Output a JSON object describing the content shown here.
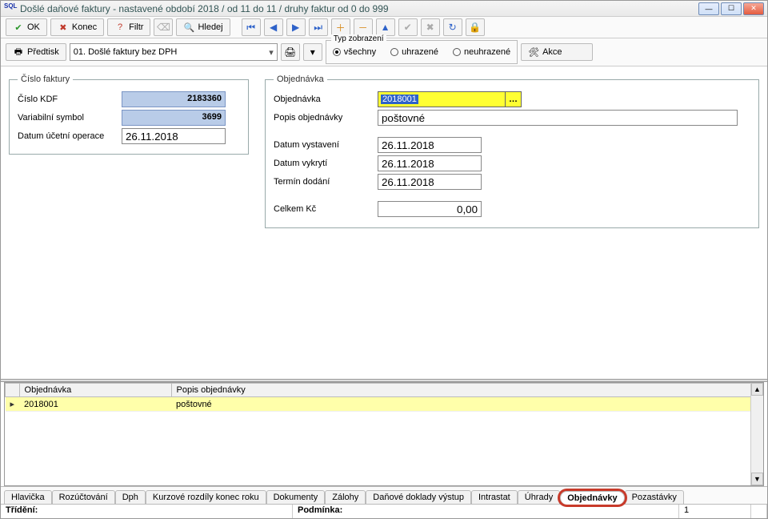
{
  "window": {
    "title": "Došlé daňové faktury - nastavené období 2018 / od 11 do 11 / druhy faktur od 0 do 999"
  },
  "toolbar1": {
    "ok": "OK",
    "konec": "Konec",
    "filtr": "Filtr",
    "hledej": "Hledej"
  },
  "toolbar2": {
    "predtisk": "Předtisk",
    "combo_value": "01. Došlé faktury bez DPH",
    "group_label": "Typ zobrazení",
    "radios": {
      "vsechny": "všechny",
      "uhrazene": "uhrazené",
      "neuhrazene": "neuhrazené"
    },
    "akce": "Akce"
  },
  "left_panel": {
    "legend": "Číslo faktury",
    "fields": {
      "cislo_kdf_label": "Číslo KDF",
      "cislo_kdf_value": "2183360",
      "var_sym_label": "Variabilní symbol",
      "var_sym_value": "3699",
      "dat_oper_label": "Datum účetní operace",
      "dat_oper_value": "26.11.2018"
    }
  },
  "right_panel": {
    "legend": "Objednávka",
    "fields": {
      "objednavka_label": "Objednávka",
      "objednavka_value": "2018001",
      "popis_label": "Popis objednávky",
      "popis_value": "poštovné",
      "dat_vyst_label": "Datum vystavení",
      "dat_vyst_value": "26.11.2018",
      "dat_vykr_label": "Datum vykrytí",
      "dat_vykr_value": "26.11.2018",
      "term_dod_label": "Termín dodání",
      "term_dod_value": "26.11.2018",
      "celkem_label": "Celkem Kč",
      "celkem_value": "0,00"
    }
  },
  "grid": {
    "columns": {
      "col1": "Objednávka",
      "col2": "Popis objednávky"
    },
    "rows": [
      {
        "objednavka": "2018001",
        "popis": "poštovné"
      }
    ],
    "row0_obj": "2018001",
    "row0_popis": "poštovné"
  },
  "tabs": {
    "hlavicka": "Hlavička",
    "rozuctovani": "Rozúčtování",
    "dph": "Dph",
    "kurz": "Kurzové rozdíly konec roku",
    "dokumenty": "Dokumenty",
    "zalohy": "Zálohy",
    "dd_vystup": "Daňové doklady výstup",
    "intrastat": "Intrastat",
    "uhrady": "Úhrady",
    "objednavky": "Objednávky",
    "pozastavky": "Pozastávky"
  },
  "status": {
    "trideni_label": "Třídění:",
    "podminka_label": "Podmínka:",
    "count": "1"
  }
}
